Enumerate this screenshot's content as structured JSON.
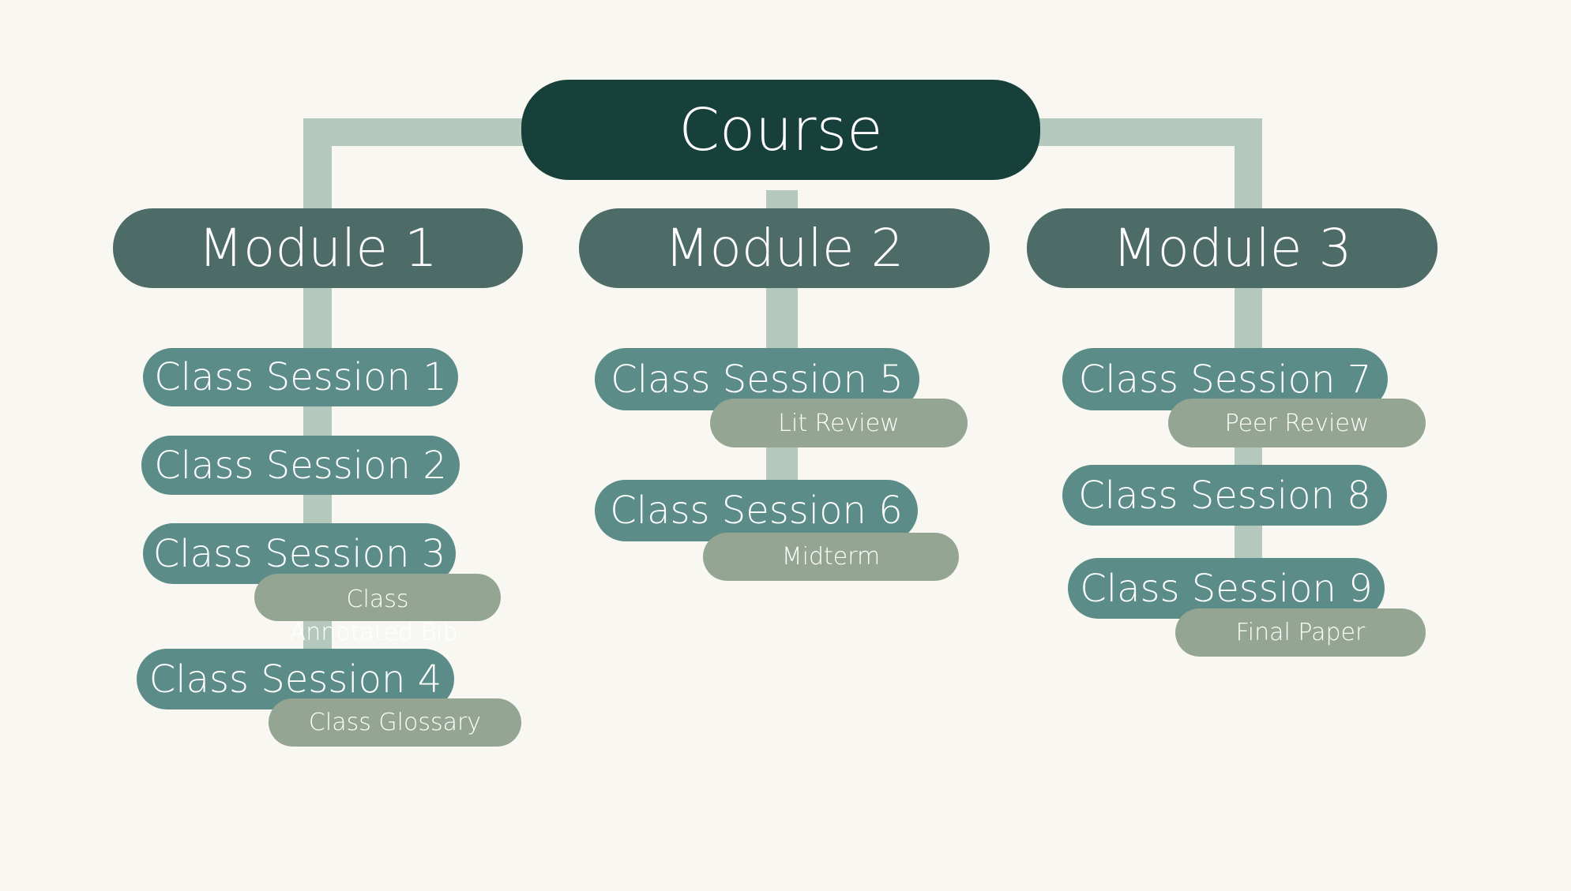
{
  "course": {
    "label": "Course"
  },
  "modules": [
    {
      "label": "Module 1"
    },
    {
      "label": "Module 2"
    },
    {
      "label": "Module 3"
    }
  ],
  "sessions": [
    {
      "label": "Class Session 1"
    },
    {
      "label": "Class Session 2"
    },
    {
      "label": "Class Session 3"
    },
    {
      "label": "Class Session 4"
    },
    {
      "label": "Class Session 5"
    },
    {
      "label": "Class Session 6"
    },
    {
      "label": "Class Session 7"
    },
    {
      "label": "Class Session 8"
    },
    {
      "label": "Class Session 9"
    }
  ],
  "deliverables": [
    {
      "label": "Class Annotated Bib."
    },
    {
      "label": "Class Glossary"
    },
    {
      "label": "Lit Review"
    },
    {
      "label": "Midterm"
    },
    {
      "label": "Peer Review"
    },
    {
      "label": "Final Paper"
    }
  ],
  "colors": {
    "course": "#18403b",
    "module": "#4d6b67",
    "session": "#5b8c87",
    "deliverable": "#95a593",
    "connector": "#b4c8bd",
    "background": "#f8f7f2"
  }
}
